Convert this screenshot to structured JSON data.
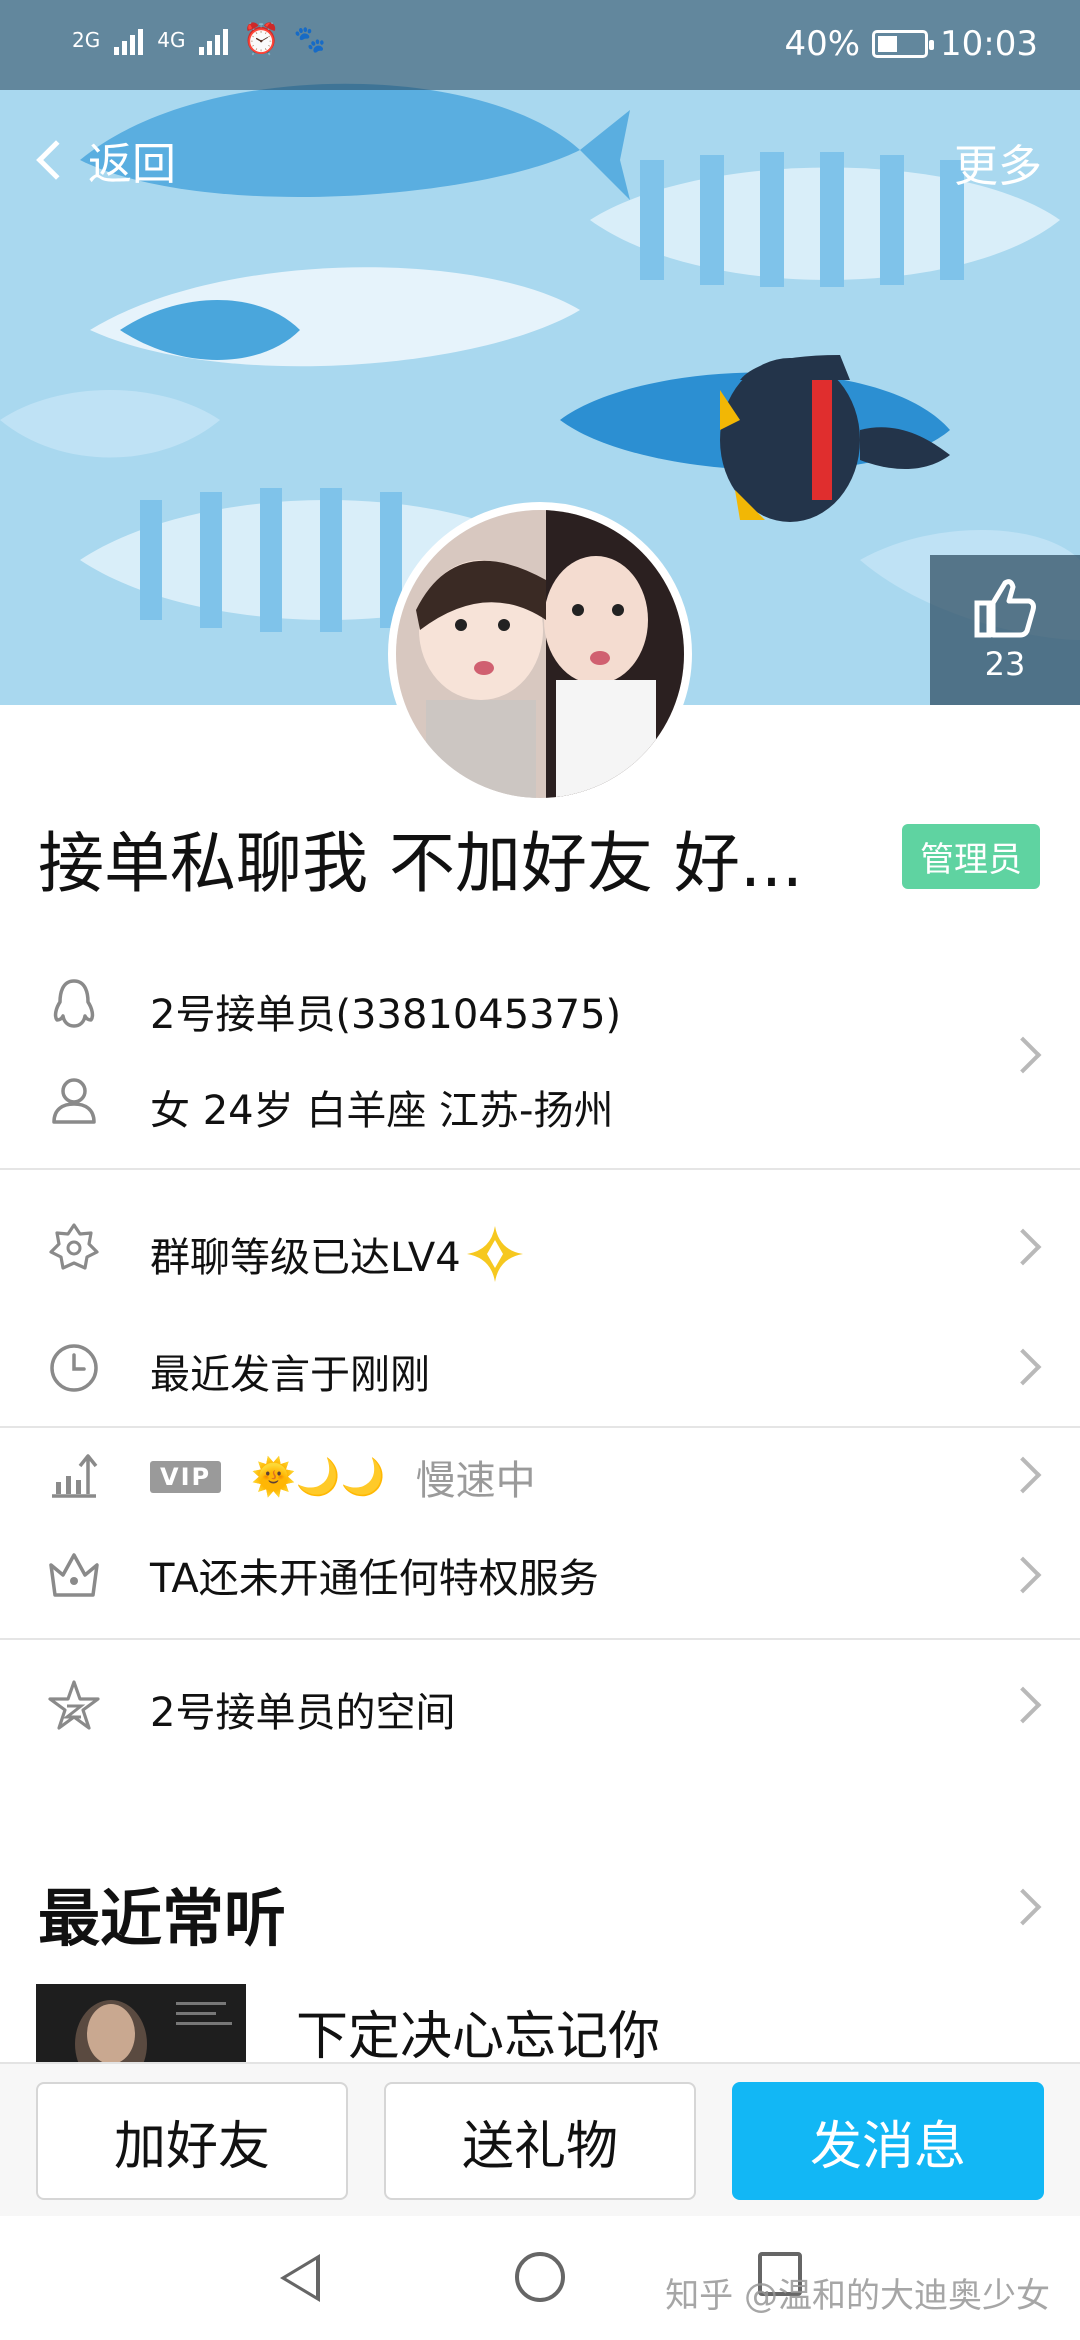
{
  "status_bar": {
    "network_1": "2G",
    "network_2": "4G",
    "battery": "40%",
    "time": "10:03"
  },
  "header": {
    "back_label": "返回",
    "more_label": "更多",
    "likes": "23"
  },
  "profile": {
    "nickname": "接单私聊我 不加好友 好...",
    "role_badge": "管理员",
    "account": "2号接单员(3381045375)",
    "details": "女  24岁  白羊座  江苏-扬州"
  },
  "info_rows": {
    "level": "群聊等级已达LV4",
    "last_active": "最近发言于刚刚",
    "vip_tag": "VIP",
    "vip_speed": "慢速中",
    "privilege": "TA还未开通任何特权服务",
    "space": "2号接单员的空间"
  },
  "music": {
    "section_title": "最近常听",
    "song_title": "下定决心忘记你"
  },
  "actions": {
    "add_friend": "加好友",
    "send_gift": "送礼物",
    "send_message": "发消息"
  },
  "watermark": "知乎 @温和的大迪奥少女",
  "colors": {
    "accent": "#12b7f5",
    "badge": "#5fd3a1",
    "banner": "#a9d8ef"
  }
}
